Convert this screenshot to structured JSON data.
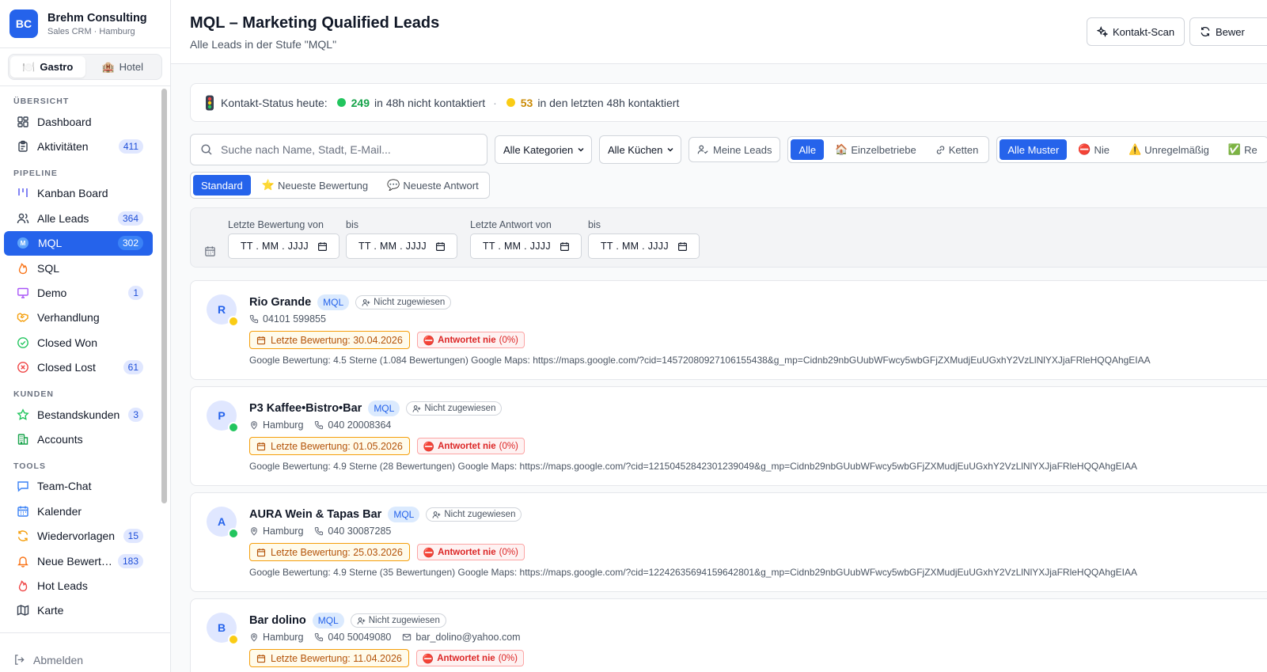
{
  "brand": {
    "logo": "BC",
    "name": "Brehm Consulting",
    "sub": "Sales CRM · Hamburg"
  },
  "segment": {
    "gastro": "Gastro",
    "hotel": "Hotel"
  },
  "nav": {
    "sections": {
      "overview": "ÜBERSICHT",
      "pipeline": "PIPELINE",
      "customers": "KUNDEN",
      "tools": "TOOLS"
    },
    "items": {
      "dashboard": {
        "label": "Dashboard"
      },
      "activities": {
        "label": "Aktivitäten",
        "count": "411"
      },
      "kanban": {
        "label": "Kanban Board"
      },
      "all_leads": {
        "label": "Alle Leads",
        "count": "364"
      },
      "mql": {
        "label": "MQL",
        "count": "302",
        "dot": "M"
      },
      "sql": {
        "label": "SQL"
      },
      "demo": {
        "label": "Demo",
        "count": "1"
      },
      "negotiation": {
        "label": "Verhandlung"
      },
      "closed_won": {
        "label": "Closed Won"
      },
      "closed_lost": {
        "label": "Closed Lost",
        "count": "61"
      },
      "existing": {
        "label": "Bestandskunden",
        "count": "3"
      },
      "accounts": {
        "label": "Accounts"
      },
      "team_chat": {
        "label": "Team-Chat"
      },
      "calendar": {
        "label": "Kalender"
      },
      "followups": {
        "label": "Wiedervorlagen",
        "count": "15"
      },
      "new_reviews": {
        "label": "Neue Bewert…",
        "count": "183"
      },
      "hot_leads": {
        "label": "Hot Leads"
      },
      "map": {
        "label": "Karte"
      }
    },
    "logout": "Abmelden"
  },
  "header": {
    "title": "MQL – Marketing Qualified Leads",
    "subtitle": "Alle Leads in der Stufe \"MQL\"",
    "contact_scan": "Kontakt-Scan",
    "reviews_btn": "Bewer"
  },
  "status": {
    "label": "Kontakt-Status heute:",
    "green_count": "249",
    "green_text": "in 48h nicht kontaktiert",
    "separator": "·",
    "yellow_count": "53",
    "yellow_text": "in den letzten 48h kontaktiert"
  },
  "filters": {
    "search_placeholder": "Suche nach Name, Stadt, E-Mail...",
    "category": "Alle Kategorien",
    "cuisine": "Alle Küchen",
    "my_leads": "Meine Leads",
    "scope": {
      "all": "Alle",
      "single": "Einzelbetriebe",
      "chains": "Ketten"
    },
    "pattern": {
      "all": "Alle Muster",
      "never": "Nie",
      "irregular": "Unregelmäßig",
      "regular": "Re"
    }
  },
  "sort": {
    "standard": "Standard",
    "newest_review": "Neueste Bewertung",
    "newest_reply": "Neueste Antwort"
  },
  "date_filter": {
    "review_from": "Letzte Bewertung von",
    "review_to": "bis",
    "reply_from": "Letzte Antwort von",
    "reply_to": "bis",
    "placeholder": "TT . MM . JJJJ"
  },
  "leads": [
    {
      "initial": "R",
      "name": "Rio Grande",
      "stage": "MQL",
      "assignee": "Nicht zugewiesen",
      "city": "",
      "phone": "04101 599855",
      "email": "",
      "last_review": "Letzte Bewertung: 30.04.2026",
      "reply_label": "Antwortet nie",
      "reply_pct": "(0%)",
      "status_color": "#facc15",
      "description": "Google Bewertung: 4.5 Sterne (1.084 Bewertungen) Google Maps: https://maps.google.com/?cid=14572080927106155438&g_mp=Cidnb29nbGUubWFwcy5wbGFjZXMudjEuUGxhY2VzLlNlYXJjaFRleHQQAhgEIAA"
    },
    {
      "initial": "P",
      "name": "P3 Kaffee•Bistro•Bar",
      "stage": "MQL",
      "assignee": "Nicht zugewiesen",
      "city": "Hamburg",
      "phone": "040 20008364",
      "email": "",
      "last_review": "Letzte Bewertung: 01.05.2026",
      "reply_label": "Antwortet nie",
      "reply_pct": "(0%)",
      "status_color": "#22c55e",
      "description": "Google Bewertung: 4.9 Sterne (28 Bewertungen) Google Maps: https://maps.google.com/?cid=12150452842301239049&g_mp=Cidnb29nbGUubWFwcy5wbGFjZXMudjEuUGxhY2VzLlNlYXJjaFRleHQQAhgEIAA"
    },
    {
      "initial": "A",
      "name": "AURA Wein & Tapas Bar",
      "stage": "MQL",
      "assignee": "Nicht zugewiesen",
      "city": "Hamburg",
      "phone": "040 30087285",
      "email": "",
      "last_review": "Letzte Bewertung: 25.03.2026",
      "reply_label": "Antwortet nie",
      "reply_pct": "(0%)",
      "status_color": "#22c55e",
      "description": "Google Bewertung: 4.9 Sterne (35 Bewertungen) Google Maps: https://maps.google.com/?cid=12242635694159642801&g_mp=Cidnb29nbGUubWFwcy5wbGFjZXMudjEuUGxhY2VzLlNlYXJjaFRleHQQAhgEIAA"
    },
    {
      "initial": "B",
      "name": "Bar dolino",
      "stage": "MQL",
      "assignee": "Nicht zugewiesen",
      "city": "Hamburg",
      "phone": "040 50049080",
      "email": "bar_dolino@yahoo.com",
      "last_review": "Letzte Bewertung: 11.04.2026",
      "reply_label": "Antwortet nie",
      "reply_pct": "(0%)",
      "status_color": "#facc15",
      "description": ""
    }
  ],
  "colors": {
    "accent": "#2563eb",
    "green": "#22c55e",
    "yellow": "#facc15",
    "danger": "#dc2626",
    "warning": "#b45309"
  }
}
